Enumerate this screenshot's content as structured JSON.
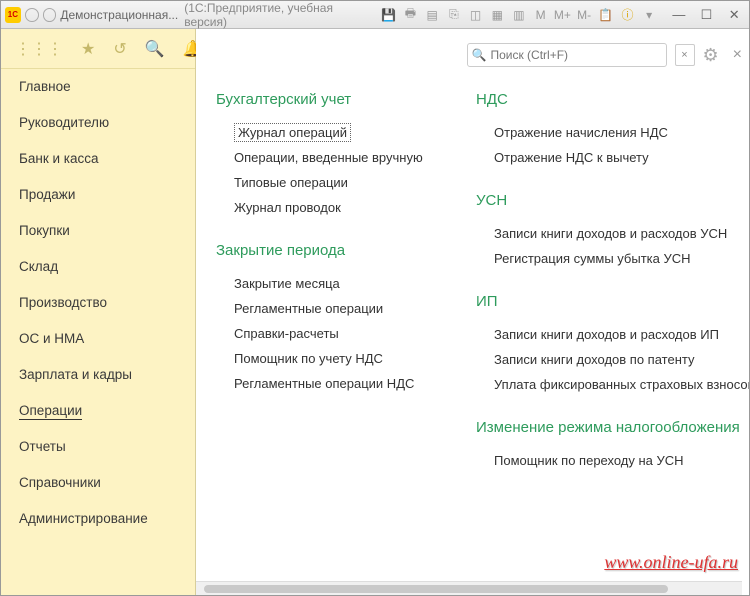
{
  "titlebar": {
    "logo": "1C",
    "title": "Демонстрационная...",
    "subtitle": "(1С:Предприятие, учебная версия)",
    "calc": {
      "m": "M",
      "mplus": "M+",
      "mminus": "M-"
    }
  },
  "search": {
    "placeholder": "Поиск (Ctrl+F)"
  },
  "sidebar": {
    "items": [
      {
        "label": "Главное"
      },
      {
        "label": "Руководителю"
      },
      {
        "label": "Банк и касса"
      },
      {
        "label": "Продажи"
      },
      {
        "label": "Покупки"
      },
      {
        "label": "Склад"
      },
      {
        "label": "Производство"
      },
      {
        "label": "ОС и НМА"
      },
      {
        "label": "Зарплата и кадры"
      },
      {
        "label": "Операции",
        "active": true
      },
      {
        "label": "Отчеты"
      },
      {
        "label": "Справочники"
      },
      {
        "label": "Администрирование"
      }
    ]
  },
  "sections": {
    "col1": [
      {
        "title": "Бухгалтерский учет",
        "links": [
          "Журнал операций",
          "Операции, введенные вручную",
          "Типовые операции",
          "Журнал проводок"
        ],
        "focused": 0
      },
      {
        "title": "Закрытие периода",
        "links": [
          "Закрытие месяца",
          "Регламентные операции",
          "Справки-расчеты",
          "Помощник по учету НДС",
          "Регламентные операции НДС"
        ]
      }
    ],
    "col2": [
      {
        "title": "НДС",
        "links": [
          "Отражение начисления НДС",
          "Отражение НДС к вычету"
        ]
      },
      {
        "title": "УСН",
        "links": [
          "Записи книги доходов и расходов УСН",
          "Регистрация суммы убытка УСН"
        ]
      },
      {
        "title": "ИП",
        "links": [
          "Записи книги доходов и расходов ИП",
          "Записи книги доходов по патенту",
          "Уплата фиксированных страховых взносов"
        ]
      },
      {
        "title": "Изменение режима налогообложения",
        "links": [
          "Помощник по переходу на УСН"
        ]
      }
    ]
  },
  "watermark": "www.online-ufa.ru"
}
